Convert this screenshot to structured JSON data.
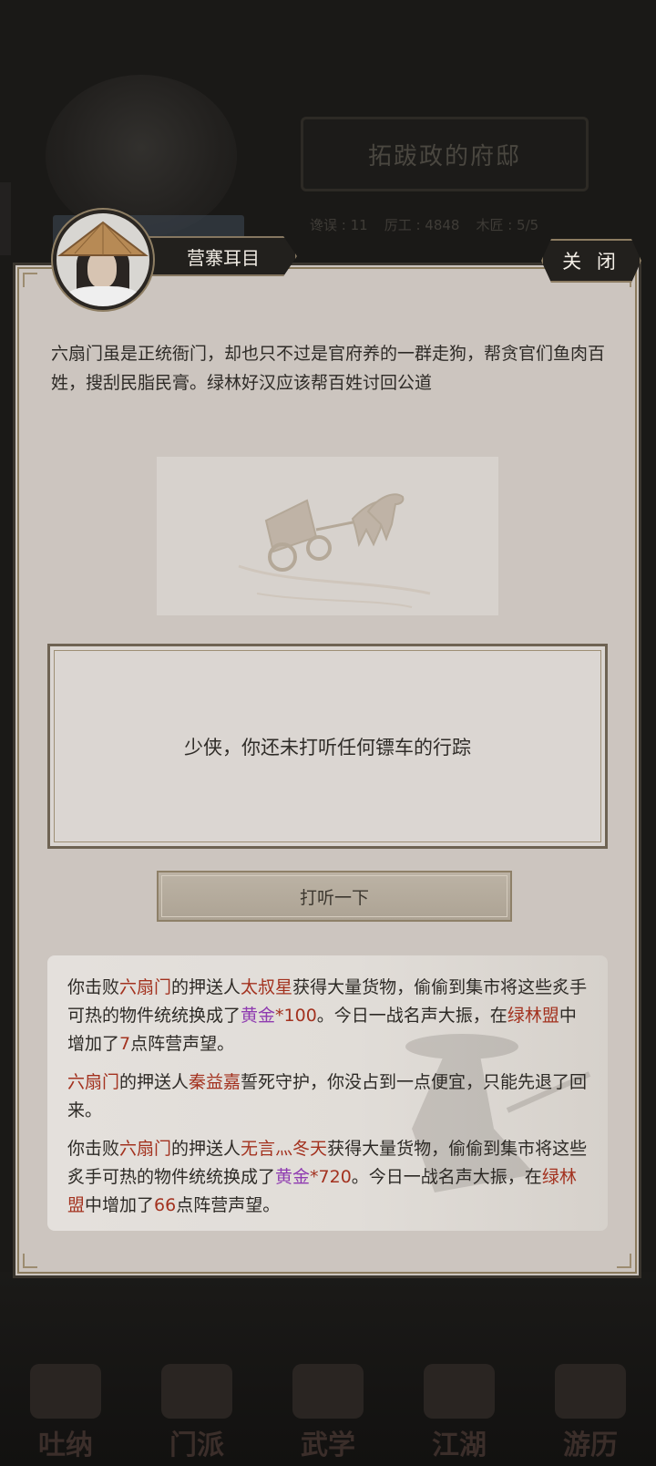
{
  "background": {
    "title": "拓跋政的府邸",
    "stats": [
      "谗误 : 11",
      "厉工 : 4848",
      "木匠 : 5/5"
    ],
    "nav": [
      "吐纳",
      "门派",
      "武学",
      "江湖",
      "游历"
    ]
  },
  "dialog": {
    "title": "营寨耳目",
    "close_label": "关 闭",
    "intro": "六扇门虽是正统衙门，却也只不过是官府养的一群走狗，帮贪官们鱼肉百姓，搜刮民脂民膏。绿林好汉应该帮百姓讨回公道",
    "info_text": "少侠，你还未打听任何镖车的行踪",
    "listen_button": "打听一下"
  },
  "log": {
    "entries": [
      {
        "p1": "你击败",
        "faction": "六扇门",
        "p2": "的押送人",
        "name": "太叔星",
        "p3": "获得大量货物，偷偷到集市将这些炙手可热的物件统统换成了",
        "item": "黄金",
        "qty": "*100",
        "p4": "。今日一战名声大振，在",
        "league": "绿林盟",
        "p5": "中增加了",
        "points": "7",
        "p6": "点阵营声望。"
      },
      {
        "faction": "六扇门",
        "p2": "的押送人",
        "name": "秦益嘉",
        "p3": "誓死守护，你没占到一点便宜，只能先退了回来。"
      },
      {
        "p1": "你击败",
        "faction": "六扇门",
        "p2": "的押送人",
        "name": "无言灬冬天",
        "p3": "获得大量货物，偷偷到集市将这些炙手可热的物件统统换成了",
        "item": "黄金",
        "qty": "*720",
        "p4": "。今日一战名声大振，在",
        "league": "绿林盟",
        "p5": "中增加了",
        "points": "66",
        "p6": "点阵营声望。"
      }
    ]
  },
  "colors": {
    "highlight_red": "#a3321f",
    "highlight_purple": "#8f3bb0",
    "panel": "#ccc5bf"
  }
}
